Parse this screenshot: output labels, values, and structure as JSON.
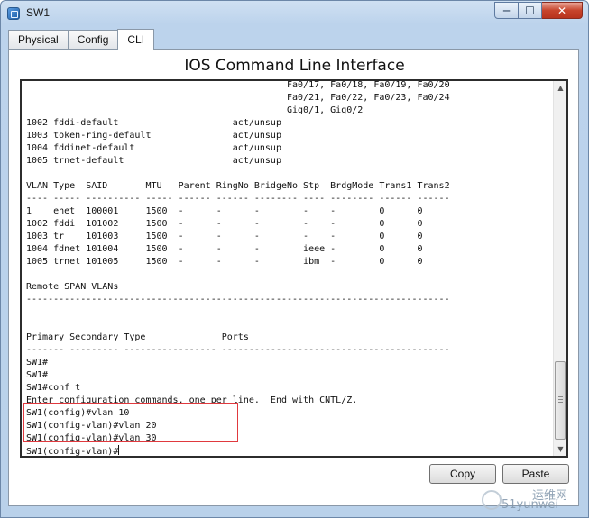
{
  "window": {
    "title": "SW1",
    "minimize_glyph": "─",
    "maximize_glyph": "☐",
    "close_glyph": "✕"
  },
  "tabs": [
    {
      "label": "Physical"
    },
    {
      "label": "Config"
    },
    {
      "label": "CLI",
      "active": true
    }
  ],
  "cli": {
    "heading": "IOS Command Line Interface",
    "lines": [
      "                                                Fa0/17, Fa0/18, Fa0/19, Fa0/20",
      "                                                Fa0/21, Fa0/22, Fa0/23, Fa0/24",
      "                                                Gig0/1, Gig0/2",
      "1002 fddi-default                     act/unsup",
      "1003 token-ring-default               act/unsup",
      "1004 fddinet-default                  act/unsup",
      "1005 trnet-default                    act/unsup",
      "",
      "VLAN Type  SAID       MTU   Parent RingNo BridgeNo Stp  BrdgMode Trans1 Trans2",
      "---- ----- ---------- ----- ------ ------ -------- ---- -------- ------ ------",
      "1    enet  100001     1500  -      -      -        -    -        0      0",
      "1002 fddi  101002     1500  -      -      -        -    -        0      0",
      "1003 tr    101003     1500  -      -      -        -    -        0      0",
      "1004 fdnet 101004     1500  -      -      -        ieee -        0      0",
      "1005 trnet 101005     1500  -      -      -        ibm  -        0      0",
      "",
      "Remote SPAN VLANs",
      "------------------------------------------------------------------------------",
      "",
      "",
      "Primary Secondary Type              Ports",
      "------- --------- ----------------- ------------------------------------------",
      "SW1#",
      "SW1#",
      "SW1#conf t",
      "Enter configuration commands, one per line.  End with CNTL/Z.",
      "SW1(config)#vlan 10",
      "SW1(config-vlan)#vlan 20",
      "SW1(config-vlan)#vlan 30"
    ],
    "prompt": "SW1(config-vlan)#"
  },
  "buttons": {
    "copy": "Copy",
    "paste": "Paste"
  },
  "watermark": {
    "top": "运维网",
    "bottom": "51yunwei"
  },
  "colors": {
    "highlight_box": "#e0393e",
    "close_button": "#c7442c"
  }
}
